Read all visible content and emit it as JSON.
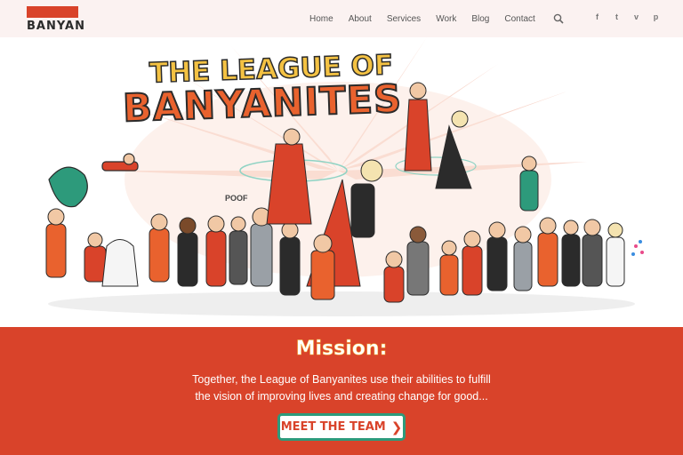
{
  "brand": {
    "logo_text": "BANYAN"
  },
  "nav": {
    "items": [
      {
        "label": "Home"
      },
      {
        "label": "About"
      },
      {
        "label": "Services"
      },
      {
        "label": "Work"
      },
      {
        "label": "Blog"
      },
      {
        "label": "Contact"
      }
    ],
    "search_icon": "search-icon"
  },
  "social": [
    {
      "icon": "facebook-icon",
      "glyph": "f"
    },
    {
      "icon": "twitter-icon",
      "glyph": "t"
    },
    {
      "icon": "vimeo-icon",
      "glyph": "v"
    },
    {
      "icon": "pinterest-icon",
      "glyph": "p"
    }
  ],
  "hero": {
    "title_line1": "THE LEAGUE OF",
    "title_line2": "BANYANITES",
    "sfx": "POOF"
  },
  "mission": {
    "title": "Mission:",
    "text_line1": "Together, the League of Banyanites use their abilities to fulfill",
    "text_line2": "the vision of improving lives and creating change for good...",
    "cta_label": "MEET THE TEAM",
    "cta_arrow": "❯"
  },
  "colors": {
    "brand_red": "#d9432a",
    "header_bg": "#fbf2f1",
    "cta_border": "#2d9a7b",
    "title_yellow": "#f4c243",
    "title_orange": "#e9622e"
  }
}
